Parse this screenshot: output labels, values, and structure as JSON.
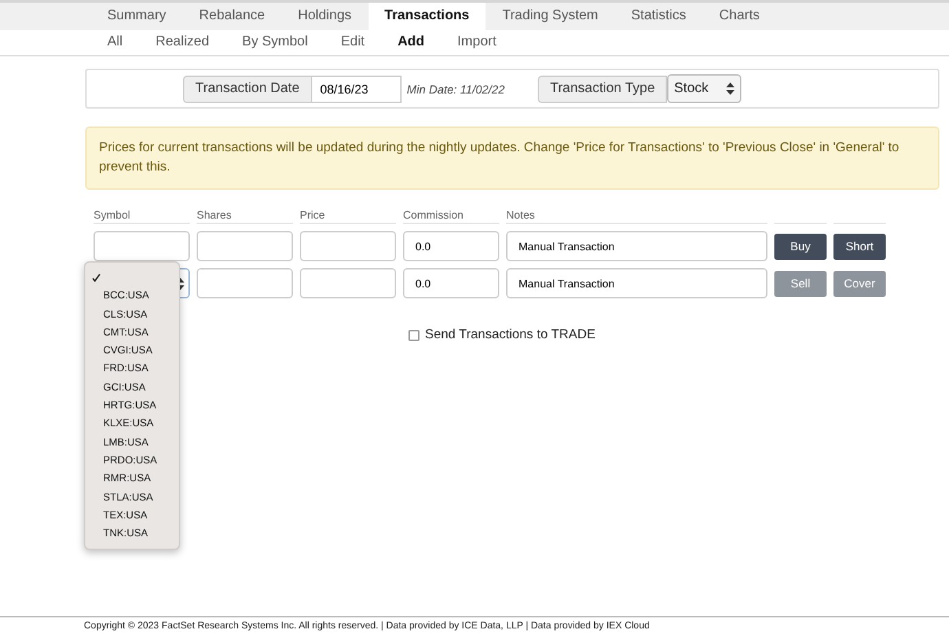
{
  "tabs": [
    {
      "label": "Summary",
      "selected": false
    },
    {
      "label": "Rebalance",
      "selected": false
    },
    {
      "label": "Holdings",
      "selected": false
    },
    {
      "label": "Transactions",
      "selected": true
    },
    {
      "label": "Trading System",
      "selected": false
    },
    {
      "label": "Statistics",
      "selected": false
    },
    {
      "label": "Charts",
      "selected": false
    }
  ],
  "subtabs": [
    {
      "label": "All",
      "selected": false
    },
    {
      "label": "Realized",
      "selected": false
    },
    {
      "label": "By Symbol",
      "selected": false
    },
    {
      "label": "Edit",
      "selected": false
    },
    {
      "label": "Add",
      "selected": true
    },
    {
      "label": "Import",
      "selected": false
    }
  ],
  "date_bar": {
    "date_label": "Transaction Date",
    "date_value": "08/16/23",
    "min_date": "Min Date: 11/02/22",
    "type_label": "Transaction Type",
    "type_value": "Stock"
  },
  "alert": "Prices for current transactions will be updated during the nightly updates. Change 'Price for Transactions' to 'Previous Close' in 'General' to prevent this.",
  "columns": [
    "Symbol",
    "Shares",
    "Price",
    "Commission",
    "Notes"
  ],
  "rows": [
    {
      "commission": "0.0",
      "notes": "Manual Transaction",
      "buttons": [
        {
          "label": "Buy",
          "disabled": false
        },
        {
          "label": "Short",
          "disabled": false
        }
      ]
    },
    {
      "commission": "0.0",
      "notes": "Manual Transaction",
      "buttons": [
        {
          "label": "Sell",
          "disabled": true
        },
        {
          "label": "Cover",
          "disabled": true
        }
      ]
    }
  ],
  "symbol_dropdown": {
    "blank_selected": true,
    "options": [
      {
        "label": "BCC:USA",
        "selected": false
      },
      {
        "label": "CLS:USA",
        "selected": false
      },
      {
        "label": "CMT:USA",
        "selected": false
      },
      {
        "label": "CVGI:USA",
        "selected": false
      },
      {
        "label": "FRD:USA",
        "selected": false
      },
      {
        "label": "GCI:USA",
        "selected": false
      },
      {
        "label": "HRTG:USA",
        "selected": false
      },
      {
        "label": "KLXE:USA",
        "selected": false
      },
      {
        "label": "LMB:USA",
        "selected": false
      },
      {
        "label": "PRDO:USA",
        "selected": false
      },
      {
        "label": "RMR:USA",
        "selected": false
      },
      {
        "label": "STLA:USA",
        "selected": false
      },
      {
        "label": "TEX:USA",
        "selected": false
      },
      {
        "label": "TNK:USA",
        "selected": false
      }
    ]
  },
  "send_to_trade": {
    "label": "Send Transactions to TRADE",
    "checked": false
  },
  "footer": "Copyright © 2023 FactSet Research Systems Inc. All rights reserved. | Data provided by ICE Data, LLP | Data provided by IEX Cloud"
}
